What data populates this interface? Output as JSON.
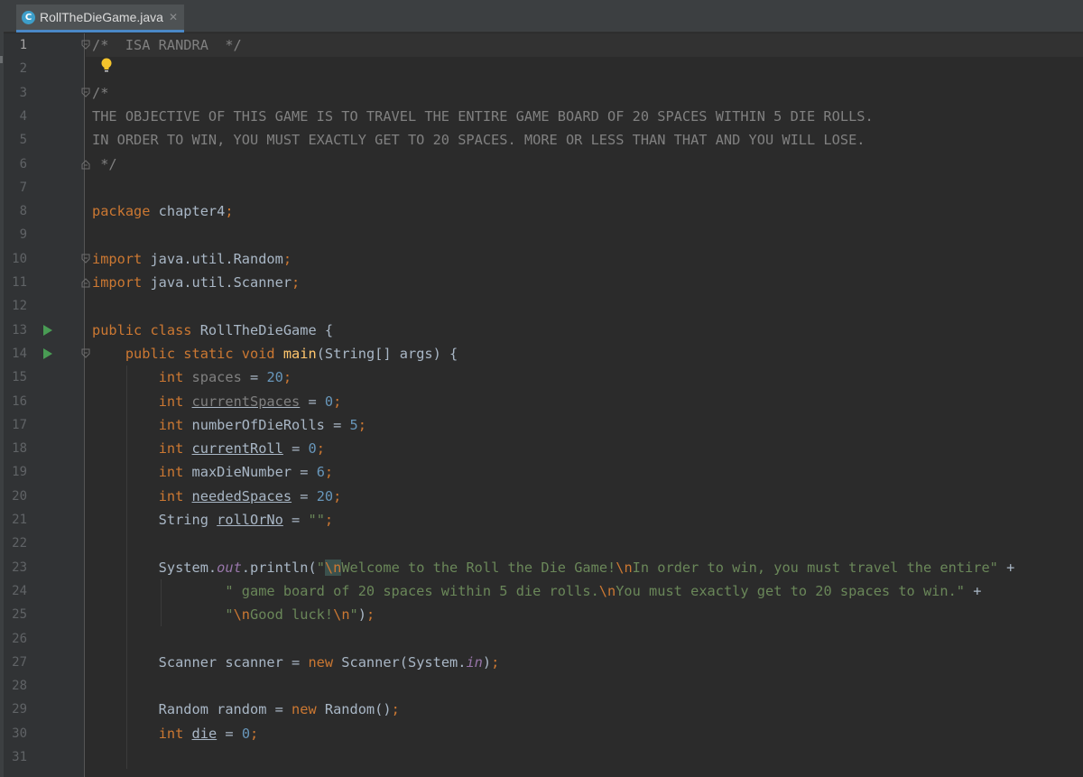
{
  "tab": {
    "title": "RollTheDieGame.java",
    "icon": "class-c-icon",
    "close": "✕"
  },
  "lines": [
    {
      "n": "1",
      "html": "<span class='c'>/*  ISA RANDRA  */</span>"
    },
    {
      "n": "2",
      "html": ""
    },
    {
      "n": "3",
      "html": "<span class='c'>/*</span>"
    },
    {
      "n": "4",
      "html": "<span class='c'>THE OBJECTIVE OF THIS GAME IS TO TRAVEL THE ENTIRE GAME BOARD OF 20 SPACES WITHIN 5 DIE ROLLS.</span>"
    },
    {
      "n": "5",
      "html": "<span class='c'>IN ORDER TO WIN, YOU MUST EXACTLY GET TO 20 SPACES. MORE OR LESS THAN THAT AND YOU WILL LOSE.</span>"
    },
    {
      "n": "6",
      "html": "<span class='c'> */</span>"
    },
    {
      "n": "7",
      "html": ""
    },
    {
      "n": "8",
      "html": "<span class='k'>package</span> chapter4<span class='k'>;</span>"
    },
    {
      "n": "9",
      "html": ""
    },
    {
      "n": "10",
      "html": "<span class='k'>import</span> java.util.Random<span class='k'>;</span>"
    },
    {
      "n": "11",
      "html": "<span class='k'>import</span> java.util.Scanner<span class='k'>;</span>"
    },
    {
      "n": "12",
      "html": ""
    },
    {
      "n": "13",
      "html": "<span class='k'>public class</span> RollTheDieGame {"
    },
    {
      "n": "14",
      "html": "    <span class='k'>public static void</span> <span class='f'>main</span>(String[] args) {"
    },
    {
      "n": "15",
      "html": "        <span class='k'>int</span> <span style='color:#808080'>spaces</span> = <span class='n'>20</span><span class='k'>;</span>"
    },
    {
      "n": "16",
      "html": "        <span class='k'>int</span> <span class='u' style='color:#808080'>currentSpaces</span> = <span class='n'>0</span><span class='k'>;</span>"
    },
    {
      "n": "17",
      "html": "        <span class='k'>int</span> numberOfDieRolls = <span class='n'>5</span><span class='k'>;</span>"
    },
    {
      "n": "18",
      "html": "        <span class='k'>int</span> <span class='u'>currentRoll</span> = <span class='n'>0</span><span class='k'>;</span>"
    },
    {
      "n": "19",
      "html": "        <span class='k'>int</span> maxDieNumber = <span class='n'>6</span><span class='k'>;</span>"
    },
    {
      "n": "20",
      "html": "        <span class='k'>int</span> <span class='u'>neededSpaces</span> = <span class='n'>20</span><span class='k'>;</span>"
    },
    {
      "n": "21",
      "html": "        String <span class='u'>rollOrNo</span> = <span class='s'>\"\"</span><span class='k'>;</span>"
    },
    {
      "n": "22",
      "html": ""
    },
    {
      "n": "23",
      "html": "        System.<span class='i'>out</span>.println(<span class='s'>\"<span class='esc hl'>\\n</span>Welcome to the Roll the Die Game!<span class='esc'>\\n</span>In order to win, you must travel the entire\"</span> +"
    },
    {
      "n": "24",
      "html": "                <span class='s'>\" game board of 20 spaces within 5 die rolls.<span class='esc'>\\n</span>You must exactly get to 20 spaces to win.\"</span> +"
    },
    {
      "n": "25",
      "html": "                <span class='s'>\"<span class='esc'>\\n</span>Good luck!<span class='esc'>\\n</span>\"</span>)<span class='k'>;</span>"
    },
    {
      "n": "26",
      "html": ""
    },
    {
      "n": "27",
      "html": "        Scanner scanner = <span class='k'>new</span> Scanner(System.<span class='i'>in</span>)<span class='k'>;</span>"
    },
    {
      "n": "28",
      "html": ""
    },
    {
      "n": "29",
      "html": "        Random random = <span class='k'>new</span> Random()<span class='k'>;</span>"
    },
    {
      "n": "30",
      "html": "        <span class='k'>int</span> <span class='u'>die</span> = <span class='n'>0</span><span class='k'>;</span>"
    },
    {
      "n": "31",
      "html": ""
    }
  ]
}
